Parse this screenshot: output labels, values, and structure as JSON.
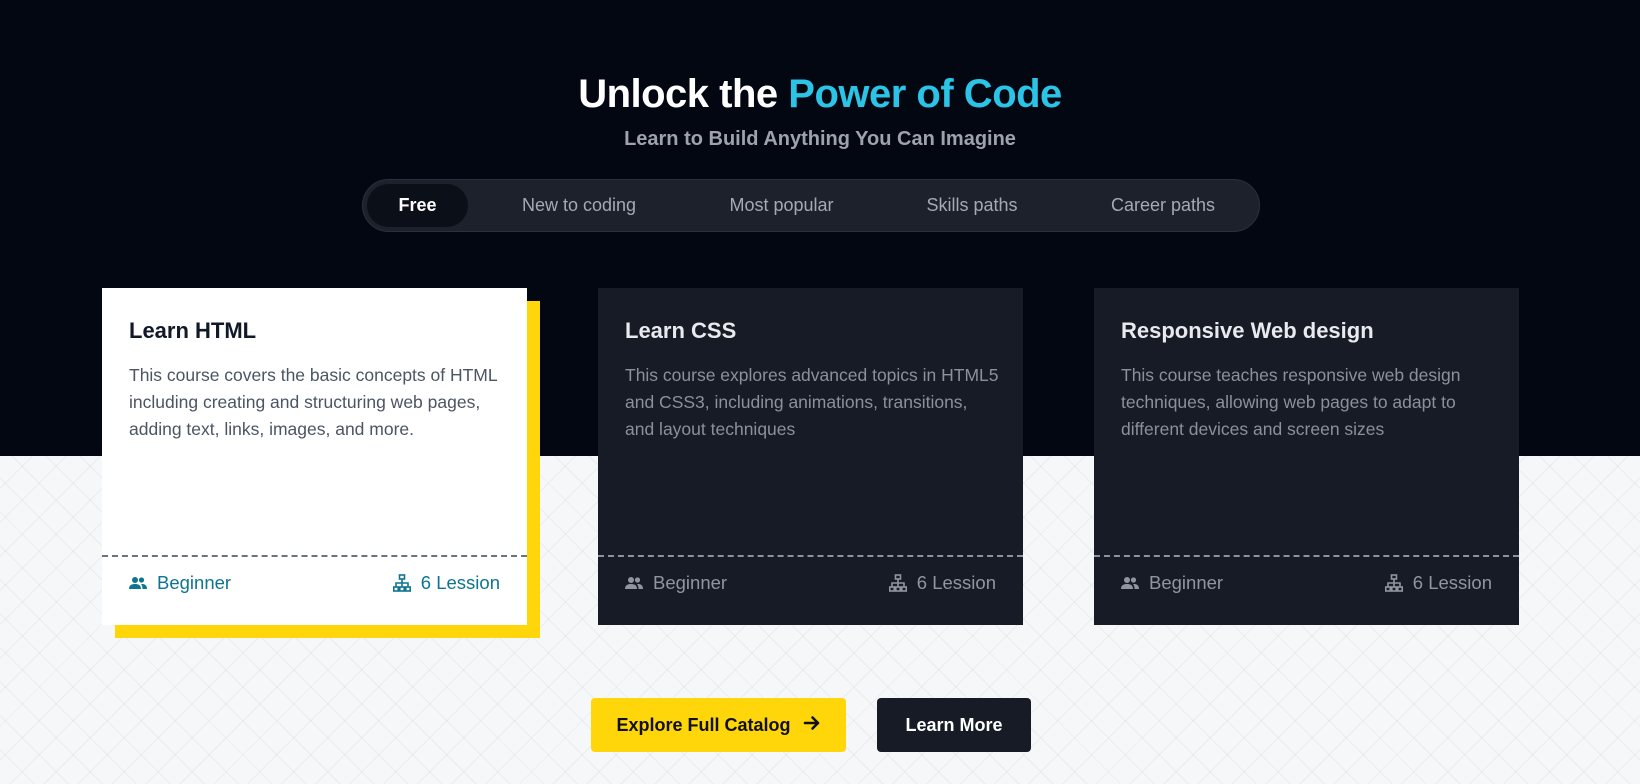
{
  "hero": {
    "title_main": "Unlock the ",
    "title_accent": "Power of Code",
    "subtitle": "Learn to Build Anything You Can Imagine"
  },
  "tabs": [
    {
      "label": "Free",
      "active": true
    },
    {
      "label": "New to coding",
      "active": false
    },
    {
      "label": "Most popular",
      "active": false
    },
    {
      "label": "Skills paths",
      "active": false
    },
    {
      "label": "Career paths",
      "active": false
    }
  ],
  "courses": [
    {
      "title": "Learn HTML",
      "description": "This course covers the basic concepts of HTML including creating and structuring web pages, adding text, links, images, and more.",
      "level": "Beginner",
      "lessons": "6 Lession",
      "featured": true
    },
    {
      "title": "Learn CSS",
      "description": "This course explores advanced topics in HTML5 and CSS3, including animations, transitions, and layout techniques",
      "level": "Beginner",
      "lessons": "6 Lession",
      "featured": false
    },
    {
      "title": "Responsive Web design",
      "description": "This course teaches responsive web design techniques, allowing web pages to adapt to different devices and screen sizes",
      "level": "Beginner",
      "lessons": "6 Lession",
      "featured": false
    }
  ],
  "actions": {
    "explore_label": "Explore Full Catalog",
    "learn_more_label": "Learn More"
  },
  "icons": {
    "level": "users-icon",
    "lessons": "sitemap-icon",
    "explore": "arrow-right-icon"
  },
  "colors": {
    "accent_cyan": "#2bc4e6",
    "highlight_yellow": "#ffd60a",
    "dark_background": "#030712",
    "card_dark": "#171b25",
    "featured_footer_teal": "#0e7490"
  }
}
